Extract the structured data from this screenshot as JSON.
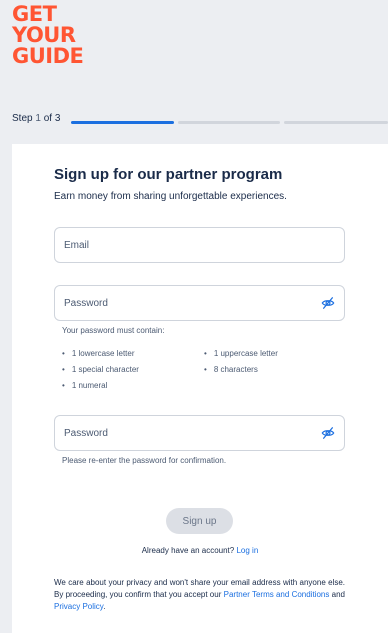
{
  "brand": {
    "logo_lines": [
      "GET",
      "YOUR",
      "GUIDE"
    ],
    "color": "#ff5533"
  },
  "stepper": {
    "prefix": "Step",
    "current": "1",
    "separator": "of",
    "total": "3",
    "active_color": "#1b6fe0",
    "progress_fraction": 0.333
  },
  "form": {
    "title": "Sign up for our partner program",
    "subtitle": "Earn money from sharing unforgettable experiences.",
    "email_placeholder": "Email",
    "password_placeholder": "Password",
    "password_rules_heading": "Your password must contain:",
    "password_rules": [
      "1 lowercase letter",
      "1 uppercase letter",
      "1 special character",
      "8 characters",
      "1 numeral"
    ],
    "confirm_placeholder": "Password",
    "confirm_hint": "Please re-enter the password for confirmation.",
    "submit_label": "Sign up",
    "eye_icon": "eye-off-icon"
  },
  "login": {
    "prompt": "Already have an account?",
    "link": "Log in"
  },
  "privacy": {
    "text": "We care about your privacy and won't share your email address with anyone else. By proceeding, you confirm that you accept our",
    "terms_link": "Partner Terms and Conditions",
    "and": "and",
    "policy_link": "Privacy Policy",
    "end": "."
  }
}
